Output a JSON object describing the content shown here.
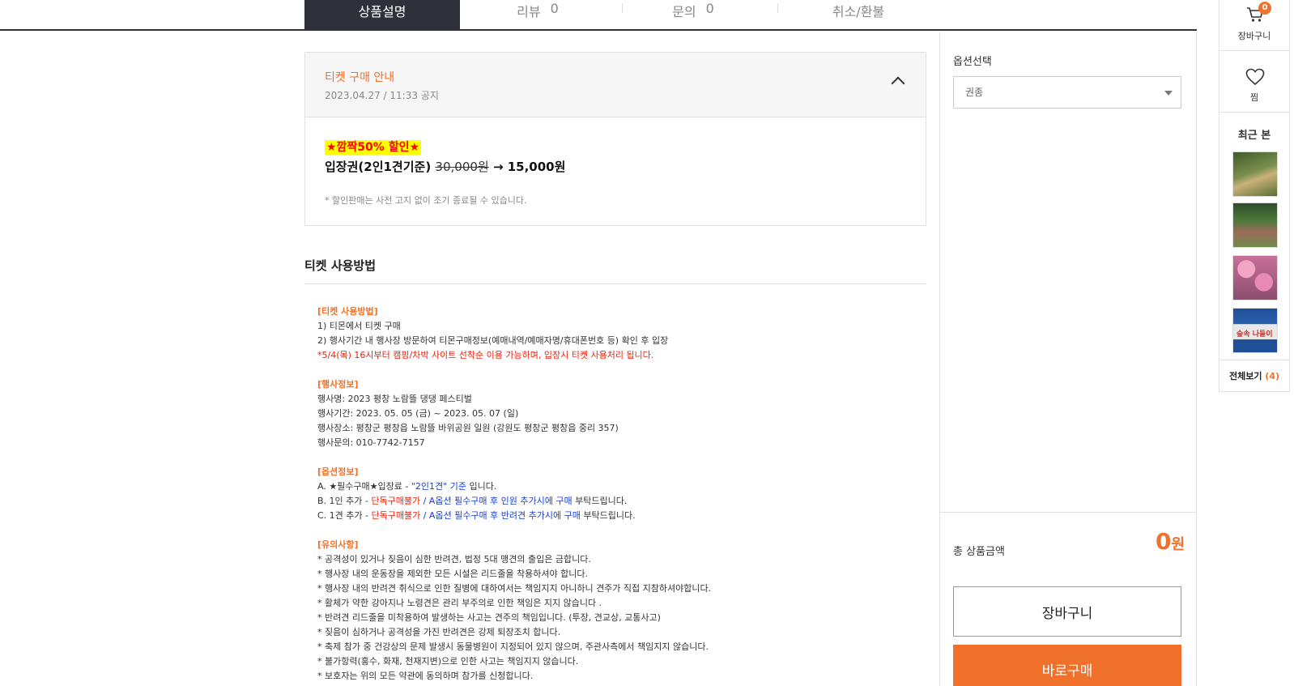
{
  "tabs": [
    {
      "label": "상품설명",
      "count": ""
    },
    {
      "label": "리뷰",
      "count": "0"
    },
    {
      "label": "문의",
      "count": "0"
    },
    {
      "label": "취소/환불",
      "count": ""
    }
  ],
  "notice": {
    "title": "티켓 구매 안내",
    "date": "2023.04.27 / 11:33 공지",
    "promo": "★깜짝50% 할인★",
    "ticket_name": "입장권(2인1견기준) ",
    "old_price": "30,000원",
    "arrow": " → ",
    "new_price": "15,000원",
    "disclaimer": "* 할인판매는 사전 고지 없이 조기 종료될 수 있습니다."
  },
  "usage": {
    "title": "티켓 사용방법",
    "h1": "[티켓 사용방법]",
    "l1": "1) 티몬에서 티켓 구매",
    "l2": "2) 행사기간 내 행사장 방문하여 티몬구매정보(예매내역/예매자명/휴대폰번호 등) 확인 후 입장",
    "l3": "*5/4(목) 16시부터 캠핑/차박 사이트 선착순 이용 가능하며, 입장시 티켓 사용처리 됩니다.",
    "h2": "[행사정보]",
    "e1": "행사명: 2023 평창 노람뜰 댕댕 페스티벌",
    "e2": "행사기간: 2023. 05. 05 (금) ~ 2023. 05. 07 (일)",
    "e3": "행사장소: 평창군 평창읍 노람뜰 바위공원 일원 (강원도 평창군 평창읍 중리 357)",
    "e4": "행사문의: 010-7742-7157",
    "h3": "[옵션정보]",
    "oa_pre": "A. ★필수구매★입장료 - ",
    "oa_blue": "\"2인1견\" 기준",
    "oa_post": " 입니다.",
    "ob_pre": "B. 1인 추가 - ",
    "ob_red": "단독구매불가",
    "ob_blue": " / A옵션 필수구매 후 인원 추가시에 구매",
    "ob_post": " 부탁드립니다.",
    "oc_pre": "C. 1견 추가 - ",
    "oc_red": "단독구매불가",
    "oc_blue": " / A옵션 필수구매 후 반려견 추가시에 구매",
    "oc_post": " 부탁드립니다.",
    "h4": "[유의사항]",
    "n1": "* 공격성이 있거나 짖음이 심한 반려견, 법정 5대 맹견의 출입은 금합니다.",
    "n2": "* 행사장 내의 운동장을 제외한 모든 시설은 리드줄을 착용하셔야 합니다.",
    "n3": "* 행사장 내의 반려견 취식으로 인한 질병에 대하여서는 책임지지 아니하니 견주가 직접 지참하셔야합니다.",
    "n4": "* 활체가 약한 강아지나 노령견은 관리 부주의로 인한 책임은 지지 않습니다 .",
    "n5": "* 반려견 리드줄을 미착용하여 발생하는 사고는 견주의 책임입니다. (투장, 견교상, 교통사고)",
    "n6": "* 짖음이 심하거나 공격성을 가진 반려견은 강제 퇴장조치 합니다.",
    "n7": "* 축제 참가 중 건강상의 문제 발생시 동물병원이 지정되어 있지 않으며, 주관사측에서 책임지지 않습니다.",
    "n8": "* 불가항력(홍수, 화재, 천재지변)으로 인한 사고는 책임지지 않습니다.",
    "n9": "* 보호자는 위의 모든 약관에 동의하며 참가를 신청합니다."
  },
  "option_panel": {
    "label": "옵션선택",
    "select_value": "권종",
    "total_label": "총 상품금액",
    "total_amount": "0",
    "total_unit": "원",
    "cart_button": "장바구니",
    "buy_button": "바로구매"
  },
  "quick_bar": {
    "cart_label": "장바구니",
    "cart_count": "0",
    "wish_label": "찜",
    "recent_label": "최근 본",
    "recent_thumb4_text": "숲속 나들이",
    "view_all_label": "전체보기 ",
    "view_all_count": "(4)"
  },
  "colors": {
    "accent": "#f0712c",
    "tab_active_bg": "#2e3139",
    "red_text": "#e8230e",
    "blue_text": "#1a3fd0"
  }
}
